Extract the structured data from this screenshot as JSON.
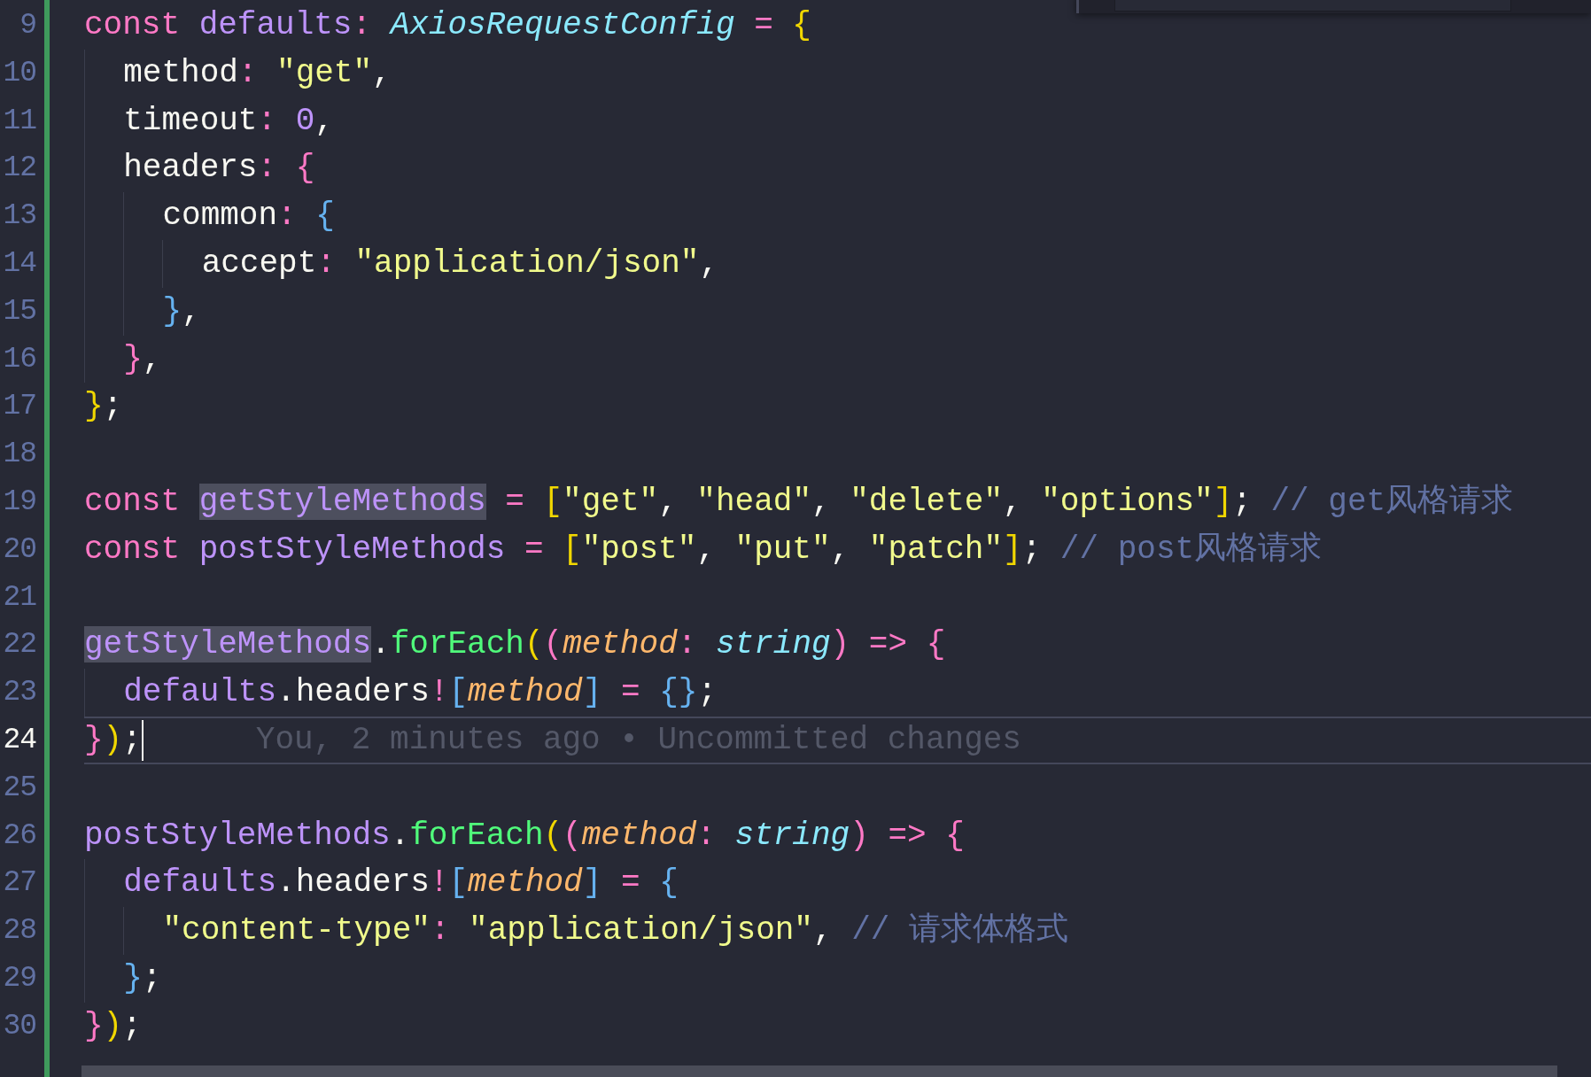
{
  "editor": {
    "git_change_bar": true,
    "lines": [
      {
        "number": "9",
        "current": false,
        "tokens": [
          {
            "kind": "keyword",
            "text": "const "
          },
          {
            "kind": "variable",
            "text": "defaults"
          },
          {
            "kind": "operator",
            "text": ": "
          },
          {
            "kind": "type",
            "text": "AxiosRequestConfig "
          },
          {
            "kind": "operator",
            "text": "= "
          },
          {
            "kind": "bracket1",
            "text": "{"
          }
        ]
      },
      {
        "number": "10",
        "current": false,
        "tokens": [
          {
            "kind": "plain",
            "text": "  method"
          },
          {
            "kind": "operator",
            "text": ": "
          },
          {
            "kind": "string",
            "text": "\"get\""
          },
          {
            "kind": "plain",
            "text": ","
          }
        ]
      },
      {
        "number": "11",
        "current": false,
        "tokens": [
          {
            "kind": "plain",
            "text": "  timeout"
          },
          {
            "kind": "operator",
            "text": ": "
          },
          {
            "kind": "number",
            "text": "0"
          },
          {
            "kind": "plain",
            "text": ","
          }
        ]
      },
      {
        "number": "12",
        "current": false,
        "tokens": [
          {
            "kind": "plain",
            "text": "  headers"
          },
          {
            "kind": "operator",
            "text": ": "
          },
          {
            "kind": "bracket2",
            "text": "{"
          }
        ]
      },
      {
        "number": "13",
        "current": false,
        "tokens": [
          {
            "kind": "plain",
            "text": "    common"
          },
          {
            "kind": "operator",
            "text": ": "
          },
          {
            "kind": "bracket3",
            "text": "{"
          }
        ]
      },
      {
        "number": "14",
        "current": false,
        "tokens": [
          {
            "kind": "plain",
            "text": "      accept"
          },
          {
            "kind": "operator",
            "text": ": "
          },
          {
            "kind": "string",
            "text": "\"application/json\""
          },
          {
            "kind": "plain",
            "text": ","
          }
        ]
      },
      {
        "number": "15",
        "current": false,
        "tokens": [
          {
            "kind": "bracket3",
            "text": "    }"
          },
          {
            "kind": "plain",
            "text": ","
          }
        ]
      },
      {
        "number": "16",
        "current": false,
        "tokens": [
          {
            "kind": "bracket2",
            "text": "  }"
          },
          {
            "kind": "plain",
            "text": ","
          }
        ]
      },
      {
        "number": "17",
        "current": false,
        "tokens": [
          {
            "kind": "bracket1",
            "text": "}"
          },
          {
            "kind": "plain",
            "text": ";"
          }
        ]
      },
      {
        "number": "18",
        "current": false
      },
      {
        "number": "19",
        "current": false,
        "tokens": [
          {
            "kind": "keyword",
            "text": "const "
          },
          {
            "kind": "occurrence",
            "text": "getStyleMethods"
          },
          {
            "kind": "operator",
            "text": " = "
          },
          {
            "kind": "bracket1",
            "text": "["
          },
          {
            "kind": "string",
            "text": "\"get\""
          },
          {
            "kind": "plain",
            "text": ", "
          },
          {
            "kind": "string",
            "text": "\"head\""
          },
          {
            "kind": "plain",
            "text": ", "
          },
          {
            "kind": "string",
            "text": "\"delete\""
          },
          {
            "kind": "plain",
            "text": ", "
          },
          {
            "kind": "string",
            "text": "\"options\""
          },
          {
            "kind": "bracket1",
            "text": "]"
          },
          {
            "kind": "plain",
            "text": "; "
          },
          {
            "kind": "comment",
            "text": "// get风格请求"
          }
        ]
      },
      {
        "number": "20",
        "current": false,
        "tokens": [
          {
            "kind": "keyword",
            "text": "const "
          },
          {
            "kind": "variable",
            "text": "postStyleMethods"
          },
          {
            "kind": "operator",
            "text": " = "
          },
          {
            "kind": "bracket1",
            "text": "["
          },
          {
            "kind": "string",
            "text": "\"post\""
          },
          {
            "kind": "plain",
            "text": ", "
          },
          {
            "kind": "string",
            "text": "\"put\""
          },
          {
            "kind": "plain",
            "text": ", "
          },
          {
            "kind": "string",
            "text": "\"patch\""
          },
          {
            "kind": "bracket1",
            "text": "]"
          },
          {
            "kind": "plain",
            "text": "; "
          },
          {
            "kind": "comment",
            "text": "// post风格请求"
          }
        ]
      },
      {
        "number": "21",
        "current": false
      },
      {
        "number": "22",
        "current": false,
        "tokens": [
          {
            "kind": "occurrence",
            "text": "getStyleMethods"
          },
          {
            "kind": "plain",
            "text": "."
          },
          {
            "kind": "function",
            "text": "forEach"
          },
          {
            "kind": "bracket1",
            "text": "("
          },
          {
            "kind": "bracket2",
            "text": "("
          },
          {
            "kind": "param",
            "text": "method"
          },
          {
            "kind": "operator",
            "text": ": "
          },
          {
            "kind": "type",
            "text": "string"
          },
          {
            "kind": "bracket2",
            "text": ") "
          },
          {
            "kind": "operator",
            "text": "=> "
          },
          {
            "kind": "bracket2",
            "text": "{"
          }
        ]
      },
      {
        "number": "23",
        "current": false,
        "tokens": [
          {
            "kind": "variable",
            "text": "  defaults"
          },
          {
            "kind": "plain",
            "text": ".headers"
          },
          {
            "kind": "operator",
            "text": "!"
          },
          {
            "kind": "bracket3",
            "text": "["
          },
          {
            "kind": "param",
            "text": "method"
          },
          {
            "kind": "bracket3",
            "text": "] "
          },
          {
            "kind": "operator",
            "text": "= "
          },
          {
            "kind": "bracket3",
            "text": "{}"
          },
          {
            "kind": "plain",
            "text": ";"
          }
        ]
      },
      {
        "number": "24",
        "current": true,
        "blame": "You, 2 minutes ago • Uncommitted changes",
        "tokens": [
          {
            "kind": "bracket2",
            "text": "}"
          },
          {
            "kind": "bracket1",
            "text": ")"
          },
          {
            "kind": "plain",
            "text": ";"
          }
        ]
      },
      {
        "number": "25",
        "current": false
      },
      {
        "number": "26",
        "current": false,
        "tokens": [
          {
            "kind": "variable",
            "text": "postStyleMethods"
          },
          {
            "kind": "plain",
            "text": "."
          },
          {
            "kind": "function",
            "text": "forEach"
          },
          {
            "kind": "bracket1",
            "text": "("
          },
          {
            "kind": "bracket2",
            "text": "("
          },
          {
            "kind": "param",
            "text": "method"
          },
          {
            "kind": "operator",
            "text": ": "
          },
          {
            "kind": "type",
            "text": "string"
          },
          {
            "kind": "bracket2",
            "text": ") "
          },
          {
            "kind": "operator",
            "text": "=> "
          },
          {
            "kind": "bracket2",
            "text": "{"
          }
        ]
      },
      {
        "number": "27",
        "current": false,
        "tokens": [
          {
            "kind": "variable",
            "text": "  defaults"
          },
          {
            "kind": "plain",
            "text": ".headers"
          },
          {
            "kind": "operator",
            "text": "!"
          },
          {
            "kind": "bracket3",
            "text": "["
          },
          {
            "kind": "param",
            "text": "method"
          },
          {
            "kind": "bracket3",
            "text": "] "
          },
          {
            "kind": "operator",
            "text": "= "
          },
          {
            "kind": "bracket3",
            "text": "{"
          }
        ]
      },
      {
        "number": "28",
        "current": false,
        "tokens": [
          {
            "kind": "string",
            "text": "    \"content-type\""
          },
          {
            "kind": "operator",
            "text": ": "
          },
          {
            "kind": "string",
            "text": "\"application/json\""
          },
          {
            "kind": "plain",
            "text": ", "
          },
          {
            "kind": "comment",
            "text": "// 请求体格式"
          }
        ]
      },
      {
        "number": "29",
        "current": false,
        "tokens": [
          {
            "kind": "bracket3",
            "text": "  }"
          },
          {
            "kind": "plain",
            "text": ";"
          }
        ]
      },
      {
        "number": "30",
        "current": false,
        "tokens": [
          {
            "kind": "bracket2",
            "text": "}"
          },
          {
            "kind": "bracket1",
            "text": ")"
          },
          {
            "kind": "plain",
            "text": ";"
          }
        ]
      }
    ]
  }
}
